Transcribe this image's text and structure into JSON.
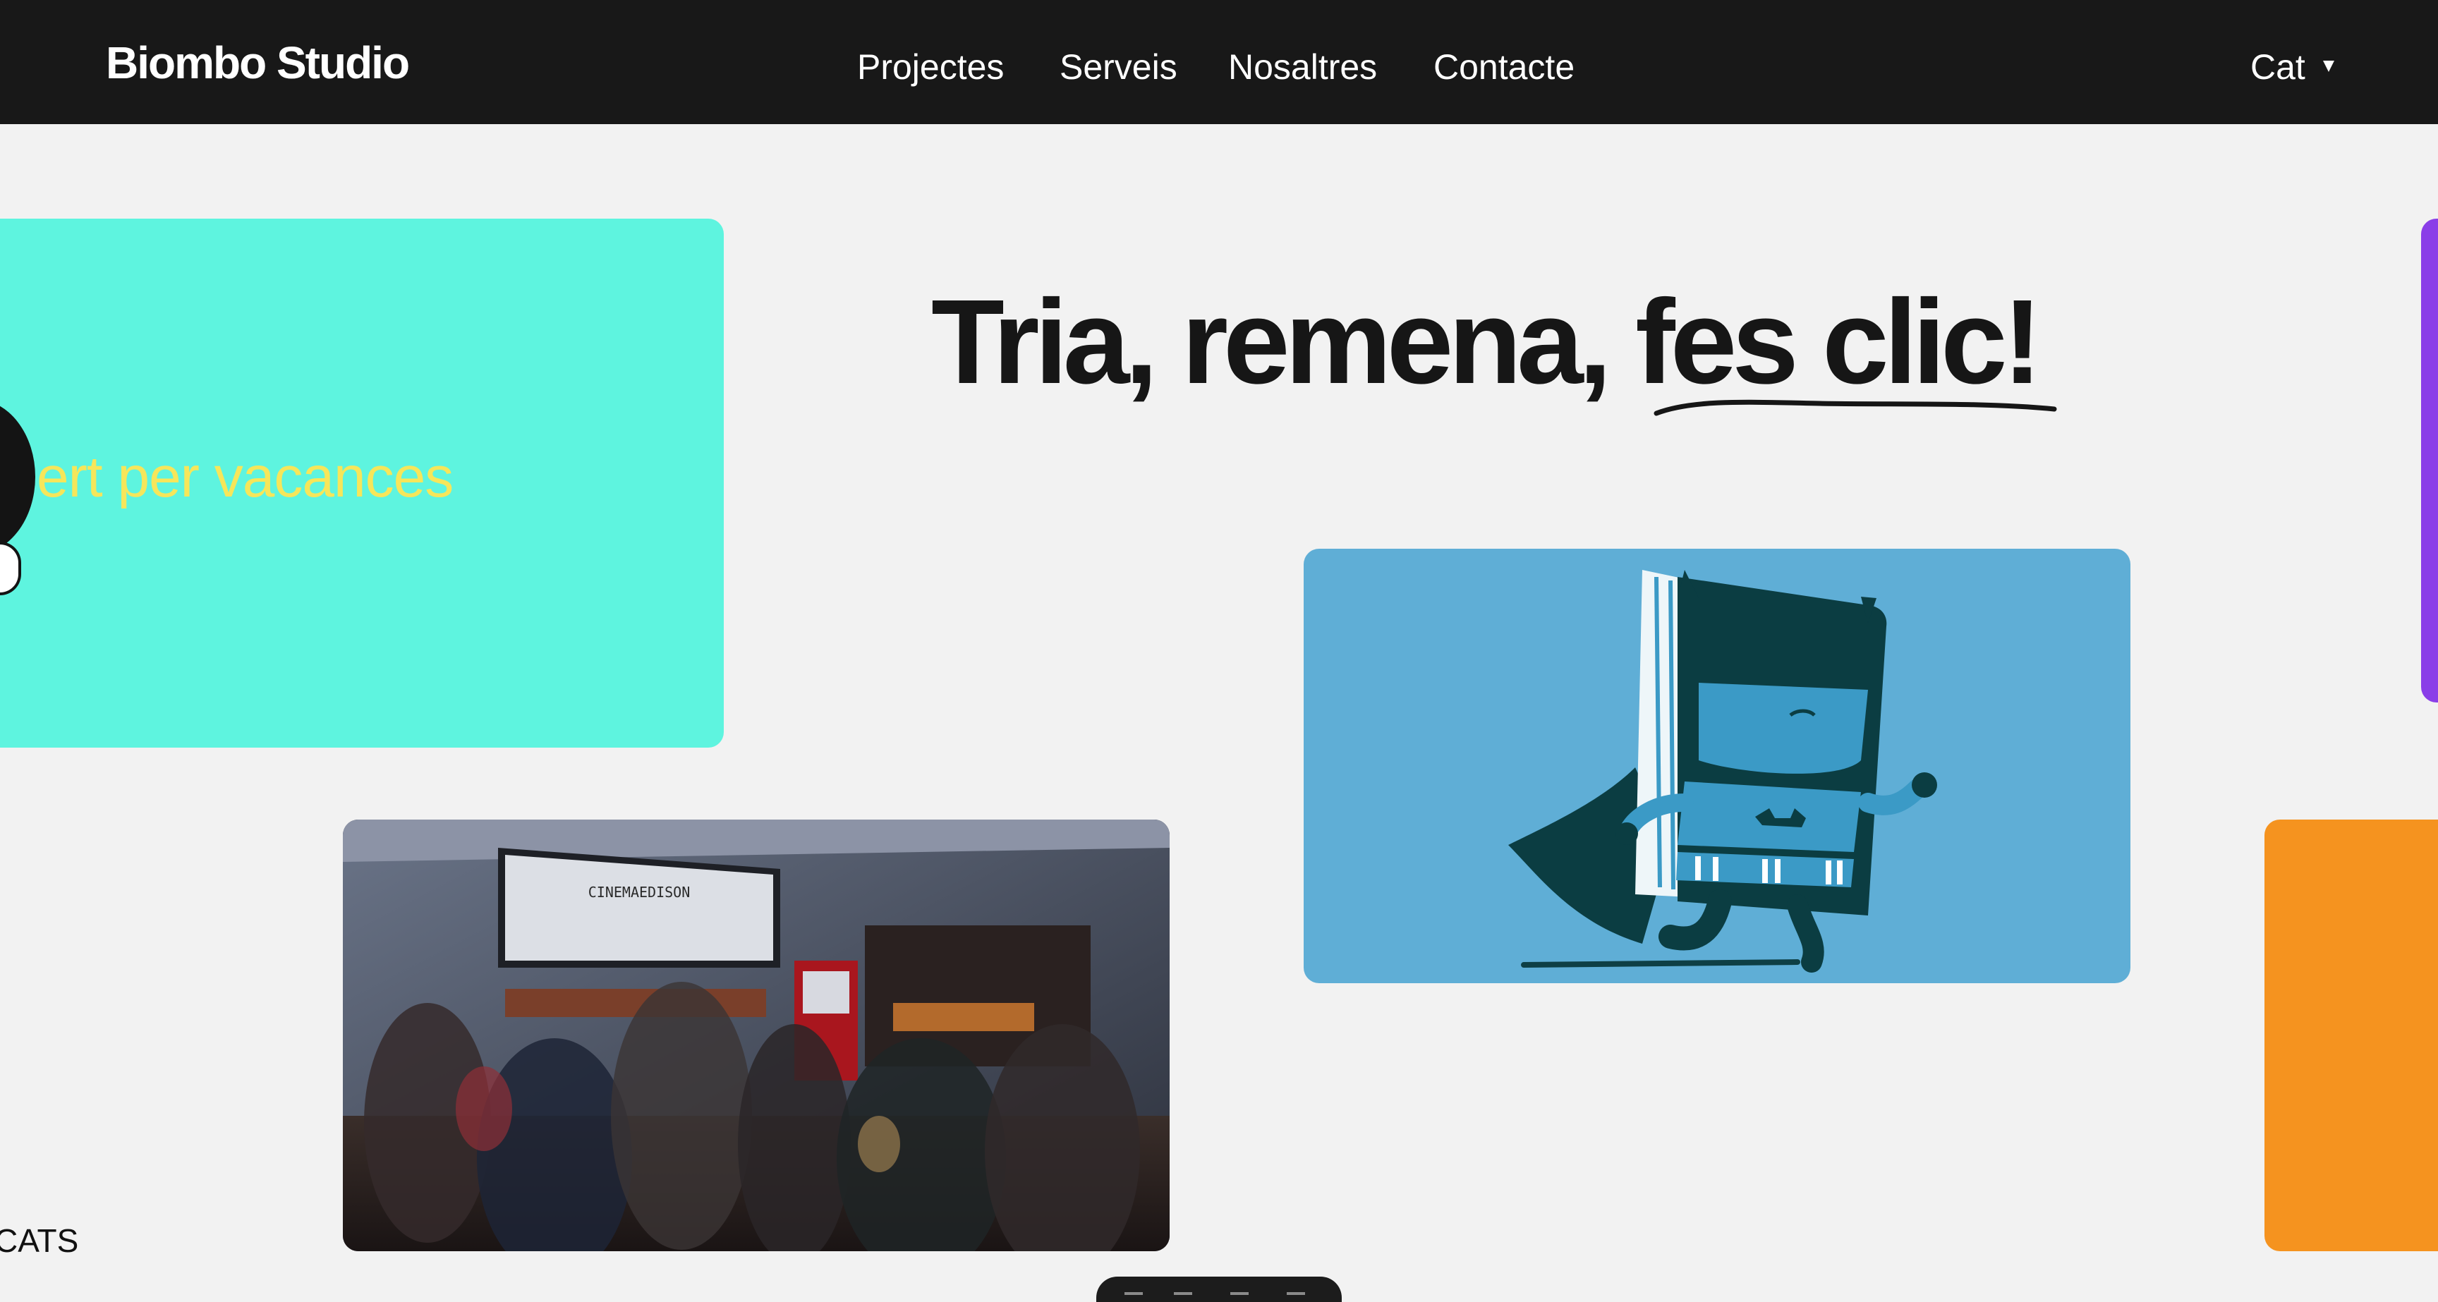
{
  "header": {
    "brand": "Biombo Studio",
    "nav": [
      {
        "label": "Projectes"
      },
      {
        "label": "Serveis"
      },
      {
        "label": "Nosaltres"
      },
      {
        "label": "Contacte"
      }
    ],
    "language": "Cat",
    "language_icon": "caret-down-icon"
  },
  "hero": {
    "headline": "Tria, remena, fes clic!",
    "headline_plain": "Tria, remena, ",
    "headline_emphasis": "fes clic!"
  },
  "cards": {
    "teal": {
      "text": "ert per vacances",
      "background": "#5ef4df",
      "text_color": "#f6e65a"
    },
    "purple": {
      "background": "#8a3ee8"
    },
    "orange": {
      "background": "#f5931f"
    },
    "blue": {
      "illustration": "book-superhero-illustration",
      "background": "#5faed6"
    },
    "photo": {
      "illustration": "cinema-lobby-photo",
      "sign": "CINEMAEDISON"
    }
  },
  "footer": {
    "label": "CATS"
  },
  "colors": {
    "header_bg": "#181818",
    "page_bg": "#f2f2f2",
    "text_dark": "#161616"
  }
}
